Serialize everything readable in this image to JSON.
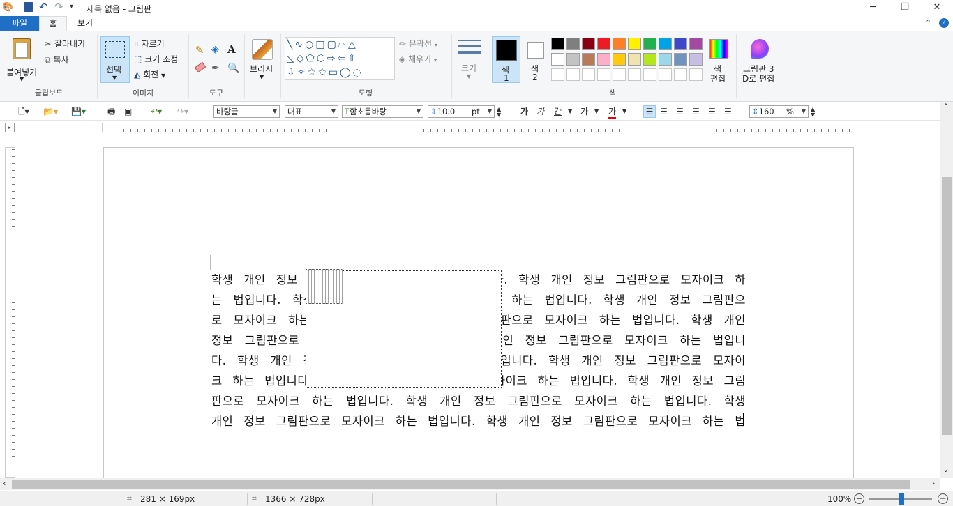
{
  "window": {
    "title": "제목 없음 - 그림판"
  },
  "tabs": {
    "file": "파일",
    "home": "홈",
    "view": "보기"
  },
  "clipboard": {
    "paste": "붙여넣기",
    "cut": "잘라내기",
    "copy": "복사",
    "label": "클립보드"
  },
  "image": {
    "select": "선택",
    "crop": "자르기",
    "resize": "크기 조정",
    "rotate": "회전",
    "label": "이미지"
  },
  "tools": {
    "label": "도구"
  },
  "brush": {
    "label": "브러시"
  },
  "shapes": {
    "outline": "윤곽선",
    "fill": "채우기",
    "label": "도형"
  },
  "size": {
    "label": "크기"
  },
  "colors": {
    "color1": "색",
    "color1_num": "1",
    "color2": "색",
    "color2_num": "2",
    "edit": "색",
    "edit2": "편집",
    "paint3d": "그림판 3",
    "paint3d2": "D로 편집",
    "label": "색",
    "palette_row1": [
      "#000000",
      "#7f7f7f",
      "#880015",
      "#ed1c24",
      "#ff7f27",
      "#fff200",
      "#22b14c",
      "#00a2e8",
      "#3f48cc",
      "#a349a4"
    ],
    "palette_row2": [
      "#ffffff",
      "#c3c3c3",
      "#b97a57",
      "#ffaec9",
      "#ffc90e",
      "#efe4b0",
      "#b5e61d",
      "#99d9ea",
      "#7092be",
      "#c8bfe7"
    ]
  },
  "format": {
    "style": "바탕글",
    "lang": "대표",
    "font": "함초롬바탕",
    "size": "10.0",
    "unit": "pt",
    "bold": "가",
    "italic": "가",
    "underline": "간",
    "strike": "가",
    "color": "가",
    "zoom": "160",
    "zoom_unit": "%"
  },
  "document": {
    "lines": [
      "학생 개인 정보 그림판으로 모자이크 하는 법입니다. 학생 개인 정보 그림판으로 모자이크 하",
      "는 법입니다. 학생 개인 정보 그림판으로 모자이크 하는 법입니다. 학생 개인 정보 그림판으",
      "로 모자이크 하는 법입니다. 학생 개인 정보 그림판으로 모자이크 하는 법입니다. 학생 개인",
      "정보 그림판으로 모자이크 하는 법입니다. 학생 개인 정보 그림판으로 모자이크 하는 법입니",
      "다. 학생 개인 정보 그림판으로 모자이크 하는 법입니다. 학생 개인 정보 그림판으로 모자이",
      "크 하는 법입니다. 학생 개인 정보 그림판으로 모자이크 하는 법입니다. 학생 개인 정보 그림",
      "판으로 모자이크 하는 법입니다. 학생 개인 정보 그림판으로 모자이크 하는 법입니다. 학생",
      "개인 정보 그림판으로 모자이크 하는 법입니다. 학생 개인 정보 그림판으로 모자이크 하는 법"
    ]
  },
  "status": {
    "selection_size": "281 × 169px",
    "image_size": "1366 × 728px",
    "zoom": "100%"
  }
}
